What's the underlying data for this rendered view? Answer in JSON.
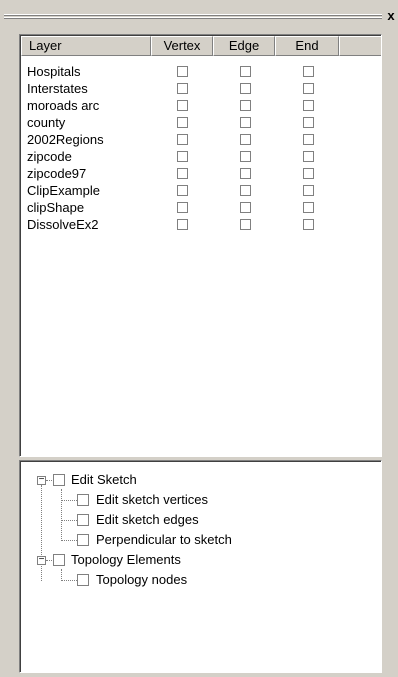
{
  "window": {
    "close_symbol": "x"
  },
  "table": {
    "columns": [
      "Layer",
      "Vertex",
      "Edge",
      "End"
    ],
    "rows": [
      {
        "layer": "Hospitals"
      },
      {
        "layer": "Interstates"
      },
      {
        "layer": "moroads arc"
      },
      {
        "layer": "county"
      },
      {
        "layer": "2002Regions"
      },
      {
        "layer": "zipcode"
      },
      {
        "layer": "zipcode97"
      },
      {
        "layer": "ClipExample"
      },
      {
        "layer": "clipShape"
      },
      {
        "layer": "DissolveEx2"
      }
    ]
  },
  "tree": {
    "groups": [
      {
        "label": "Edit Sketch",
        "expander": "−",
        "children": [
          {
            "label": "Edit sketch vertices"
          },
          {
            "label": "Edit sketch edges"
          },
          {
            "label": "Perpendicular to sketch"
          }
        ]
      },
      {
        "label": "Topology Elements",
        "expander": "−",
        "children": [
          {
            "label": "Topology nodes"
          }
        ]
      }
    ]
  }
}
